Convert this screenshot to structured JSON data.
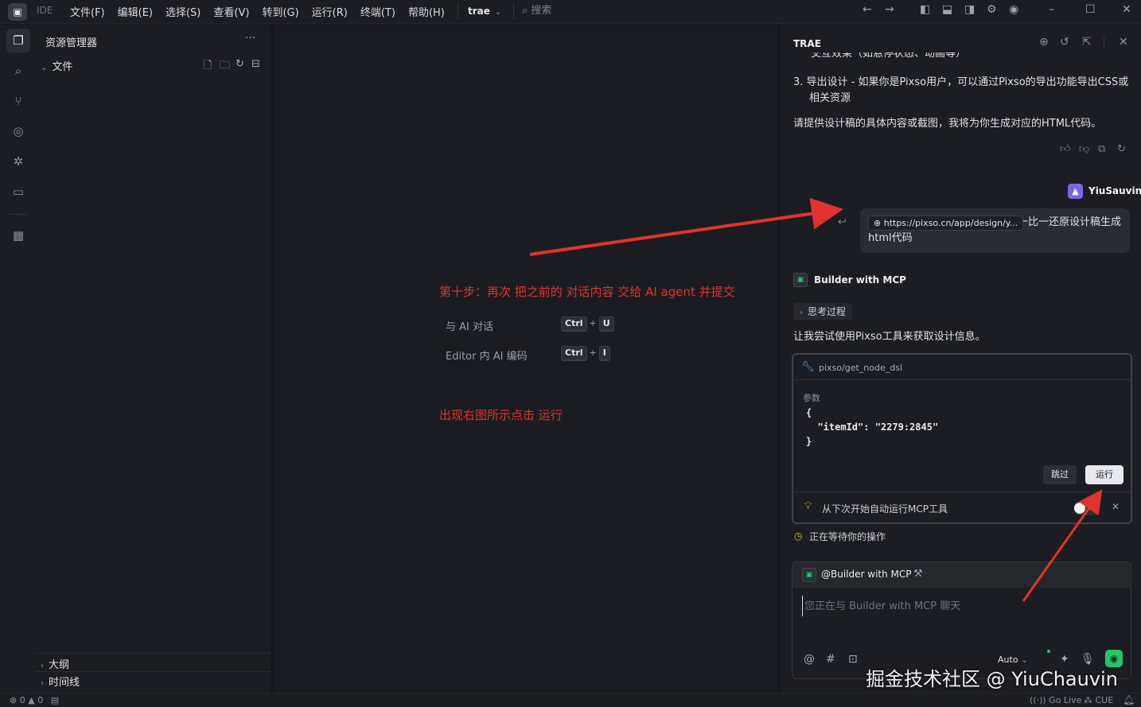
{
  "titlebar": {
    "app_label": "IDE",
    "menu": [
      "文件(F)",
      "编辑(E)",
      "选择(S)",
      "查看(V)",
      "转到(G)",
      "运行(R)",
      "终端(T)",
      "帮助(H)"
    ],
    "project": "trae",
    "search_placeholder": "搜索"
  },
  "explorer": {
    "title": "资源管理器",
    "folder": "文件",
    "outline": "大纲",
    "timeline": "时间线"
  },
  "editor": {
    "annotation_step": "第十步：再次 把之前的 对话内容 交给 AI agent 并提交",
    "shortcuts": [
      {
        "label": "与 AI 对话",
        "keys": [
          "Ctrl",
          "U"
        ]
      },
      {
        "label": "Editor 内 AI 编码",
        "keys": [
          "Ctrl",
          "I"
        ]
      }
    ],
    "annotation_run": "出现右图所示点击 运行"
  },
  "chat": {
    "title": "TRAE",
    "clipped_line": "交互效果（如悬停状态、动画等）",
    "step3": "3. 导出设计 - 如果你是Pixso用户，可以通过Pixso的导出功能导出CSS或相关资源",
    "request": "请提供设计稿的具体内容或截图，我将为你生成对应的HTML代码。",
    "user_name": "YiuSauvin",
    "user_link": "https://pixso.cn/app/design/y...",
    "user_message": "一比一还原设计稿生成html代码",
    "agent_name": "Builder with MCP",
    "thinking": "思考过程",
    "agent_message": "让我尝试使用Pixso工具来获取设计信息。",
    "tool": {
      "name": "pixso/get_node_dsl",
      "params_label": "参数",
      "code": "{\n  \"itemId\": \"2279:2845\"\n}",
      "skip_label": "跳过",
      "run_label": "运行",
      "auto_run_label": "从下次开始自动运行MCP工具"
    },
    "waiting": "正在等待你的操作",
    "input": {
      "agent_tag": "@Builder with MCP",
      "placeholder": "您正在与 Builder with MCP 聊天",
      "model": "Auto"
    }
  },
  "statusbar": {
    "errors": "0",
    "warnings": "0",
    "go_live": "Go Live",
    "cue": "CUE"
  },
  "watermark": "掘金技术社区 @ YiuChauvin",
  "colors": {
    "background": "#16171c",
    "panel": "#1c1d22",
    "annotation_red": "#e0322f",
    "accent_green": "#27c46b",
    "user_purple": "#7b66e8"
  }
}
